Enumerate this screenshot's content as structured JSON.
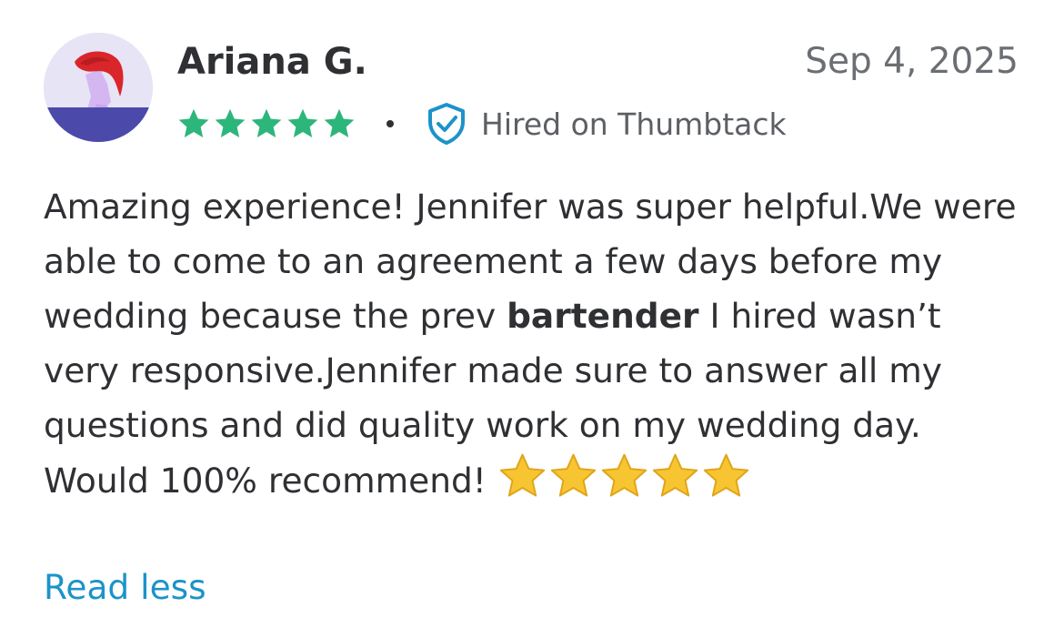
{
  "review": {
    "author": "Ariana G.",
    "date": "Sep 4, 2025",
    "rating": 5,
    "rating_max": 5,
    "separator": "•",
    "hired_label": "Hired on Thumbtack",
    "body": {
      "text_before_bold": "Amazing experience! Jennifer was super helpful.We were able to come to an agreement a few days before my wedding because the prev ",
      "bold": "bartender",
      "text_after_bold": " I hired wasn’t very responsive.Jennifer made sure to answer all my questions and did quality work on my wedding day.",
      "closing_line": "Would 100% recommend!",
      "emoji_star_count": 5
    },
    "read_less_label": "Read less"
  },
  "icons": {
    "avatar": "avatar-illustration",
    "rating_star": "star-icon",
    "verified": "shield-check-icon",
    "emoji_star": "star-emoji-icon"
  },
  "colors": {
    "text": "#2f3033",
    "muted": "#6b6e73",
    "star_green": "#2db67c",
    "verified_blue": "#1c93c9",
    "link_blue": "#1c93c9",
    "emoji_star": "#f7c531"
  }
}
